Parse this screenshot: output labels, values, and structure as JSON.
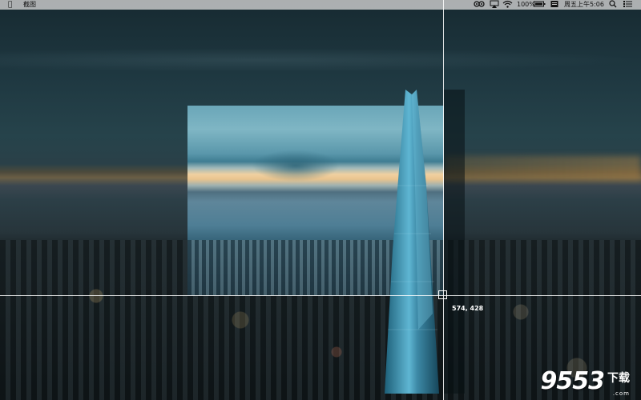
{
  "menubar": {
    "app_name": "截图",
    "battery_percent": "100%",
    "datetime": "周五上午5:06",
    "icons": [
      "apple-icon",
      "owl-icon",
      "airplay-icon",
      "wifi-icon",
      "battery-icon",
      "input-method-icon",
      "search-icon",
      "menu-list-icon"
    ]
  },
  "capture": {
    "coordinates": "574, 428"
  },
  "watermark": {
    "digits": "9553",
    "chinese": "下载",
    "url": ".com"
  }
}
